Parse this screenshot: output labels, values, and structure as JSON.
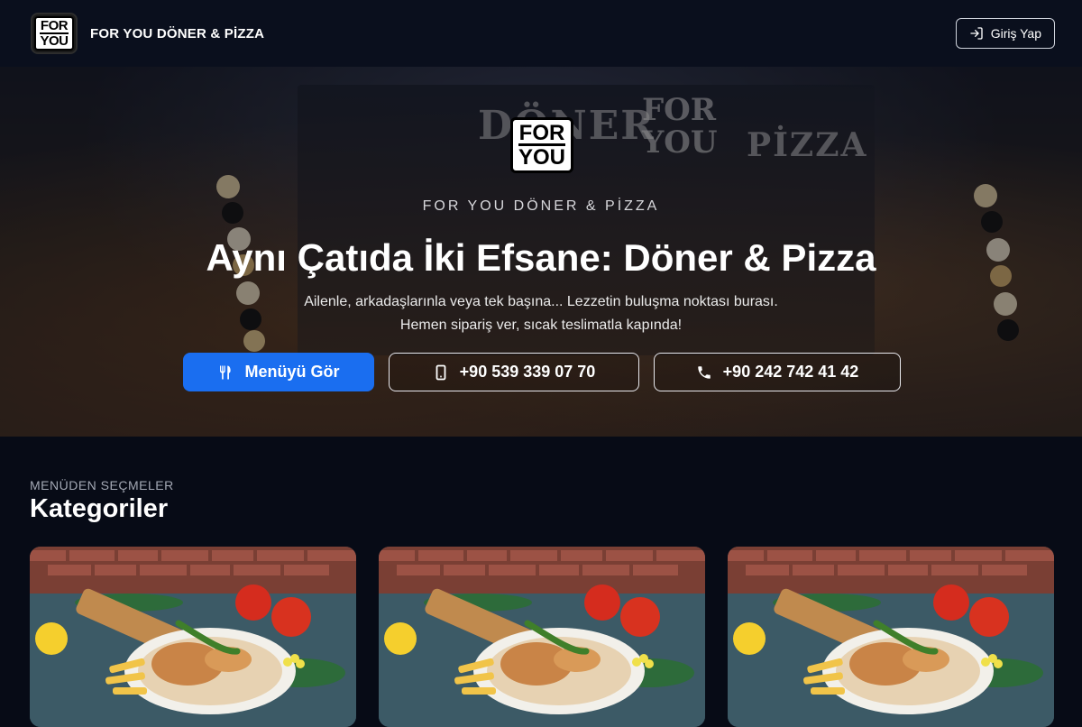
{
  "header": {
    "logo_line1": "FOR",
    "logo_line2": "YOU",
    "brand": "FOR YOU DÖNER & PİZZA",
    "login_label": "Giriş Yap"
  },
  "hero": {
    "logo_line1": "FOR",
    "logo_line2": "YOU",
    "subtitle": "FOR YOU DÖNER & PİZZA",
    "title": "Aynı Çatıda İki Efsane: Döner & Pizza",
    "description_line1": "Ailenle, arkadaşlarınla veya tek başına... Lezzetin buluşma noktası burası.",
    "description_line2": "Hemen sipariş ver, sıcak teslimatla kapında!",
    "buttons": {
      "menu": "Menüyü Gör",
      "phone1": "+90 539 339 07 70",
      "phone2": "+90 242 742 41 42"
    },
    "sign_doner": "DÖNER",
    "sign_foryou_1": "FOR",
    "sign_foryou_2": "YOU",
    "sign_pizza": "PİZZA"
  },
  "categories": {
    "eyebrow": "MENÜDEN SEÇMELER",
    "title": "Kategoriler",
    "cards": [
      {
        "image": "doner-plate"
      },
      {
        "image": "doner-plate"
      },
      {
        "image": "doner-plate"
      }
    ]
  },
  "colors": {
    "background": "#070b16",
    "topbar": "#0a0f1d",
    "primary": "#1a6ef0"
  }
}
